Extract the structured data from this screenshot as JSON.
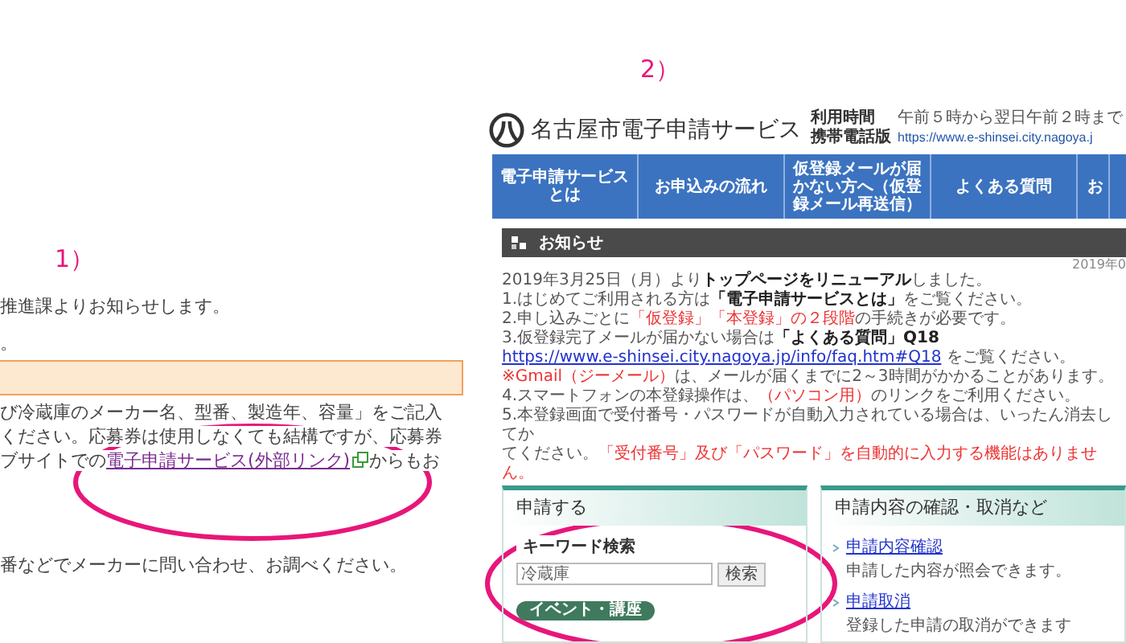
{
  "annotation_labels": [
    "1）",
    "2）"
  ],
  "left_page": {
    "lines": [
      [
        {
          "kind": "plain",
          "text": "推進課よりお知らせします。"
        }
      ],
      [
        {
          "kind": "plain",
          "text": "。"
        }
      ],
      [
        {
          "kind": "box"
        }
      ],
      [
        {
          "kind": "plain",
          "text": "び冷蔵庫のメーカー名、型番、製造年、容量」をご記入"
        }
      ],
      [
        {
          "kind": "plain",
          "text": "ください。応募券は使用しなくても結構ですが、応募券"
        }
      ],
      [
        {
          "kind": "plain",
          "text": "ブサイトでの"
        },
        {
          "kind": "link",
          "text": "電子申請サービス(外部リンク)"
        },
        {
          "kind": "plain",
          "text": "からもお"
        }
      ],
      [
        {
          "kind": "gap"
        }
      ],
      [
        {
          "kind": "plain",
          "text": "番などでメーカーに問い合わせ、お調べください。"
        }
      ]
    ]
  },
  "right_page": {
    "site_title": "名古屋市電子申請サービス",
    "hours_label": "利用時間",
    "hours_value": "午前５時から翌日午前２時まで",
    "mobile_label": "携帯電話版",
    "mobile_url": "https://www.e-shinsei.city.nagoya.j",
    "nav": [
      "電子申請サービスとは",
      "お申込みの流れ",
      "仮登録メールが届かない方へ（仮登録メール再送信）",
      "よくある質問",
      "お"
    ],
    "notice_heading": "お知らせ",
    "date": "2019年0",
    "notice_lines": [
      [
        {
          "kind": "plain",
          "text": "2019年3月25日（月）より"
        },
        {
          "kind": "bold",
          "text": "トップページをリニューアル"
        },
        {
          "kind": "plain",
          "text": "しました。"
        }
      ],
      [
        {
          "kind": "plain",
          "text": "1.はじめてご利用される方は"
        },
        {
          "kind": "bold",
          "text": "「電子申請サービスとは」"
        },
        {
          "kind": "plain",
          "text": "をご覧ください。"
        }
      ],
      [
        {
          "kind": "plain",
          "text": "2.申し込みごとに"
        },
        {
          "kind": "red",
          "text": "「仮登録」「本登録」の２段階"
        },
        {
          "kind": "plain",
          "text": "の手続きが必要です。"
        }
      ],
      [
        {
          "kind": "plain",
          "text": "3.仮登録完了メールが届かない場合は"
        },
        {
          "kind": "bold",
          "text": "「よくある質問」Q18 "
        },
        {
          "kind": "link",
          "text": "https://www.e-shinsei.city.nagoya.jp/info/faq.htm#Q18"
        },
        {
          "kind": "plain",
          "text": " をご覧ください。"
        }
      ],
      [
        {
          "kind": "red",
          "text": "※Gmail（ジーメール）"
        },
        {
          "kind": "plain",
          "text": "は、メールが届くまでに2～3時間がかかることがあります。"
        }
      ],
      [
        {
          "kind": "plain",
          "text": "4.スマートフォンの本登録操作は、"
        },
        {
          "kind": "red",
          "text": "（パソコン用）"
        },
        {
          "kind": "plain",
          "text": "のリンクをご利用ください。"
        }
      ],
      [
        {
          "kind": "plain",
          "text": "5.本登録画面で受付番号・パスワードが自動入力されている場合は、いったん消去してか"
        }
      ],
      [
        {
          "kind": "plain",
          "text": "てください。"
        },
        {
          "kind": "red",
          "text": "「受付番号」及び「パスワード」を自動的に入力する機能はありません。"
        }
      ]
    ],
    "apply_panel": {
      "title": "申請する",
      "search_label": "キーワード検索",
      "search_value": "冷蔵庫",
      "search_button": "検索",
      "tag": "イベント・講座"
    },
    "manage_panel": {
      "title": "申請内容の確認・取消など",
      "items": [
        {
          "link": "申請内容確認",
          "description": "申請した内容が照会できます。"
        },
        {
          "link": "申請取消",
          "description": "登録した申請の取消ができます"
        }
      ]
    }
  }
}
